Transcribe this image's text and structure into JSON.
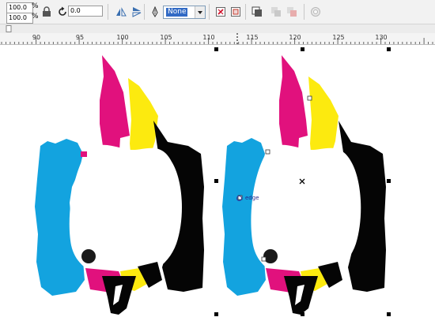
{
  "toolbar": {
    "scale_x": "100.0",
    "scale_y": "100.0",
    "percent_symbol": "%",
    "rotation": "0.0",
    "outline_dropdown": {
      "selected": "None"
    },
    "icons": [
      "lock-ratio-icon",
      "rotate-icon",
      "mirror-horizontal-icon",
      "mirror-vertical-icon",
      "pen-outline-icon",
      "dropdown-arrow-icon",
      "node-tool-icon",
      "transform-icon",
      "order-icon",
      "combine-icon",
      "break-apart-icon",
      "weld-icon"
    ]
  },
  "tab_strip": {
    "icons": [
      "page-tab-icon"
    ]
  },
  "ruler": {
    "ticks": [
      "90",
      "95",
      "100",
      "105",
      "110",
      "115",
      "120",
      "125",
      "130"
    ]
  },
  "canvas": {
    "node_label": "edge",
    "artwork_colors": {
      "cyan": "#13a3df",
      "magenta": "#e1117d",
      "yellow": "#fcea0f",
      "black": "#050505"
    }
  }
}
